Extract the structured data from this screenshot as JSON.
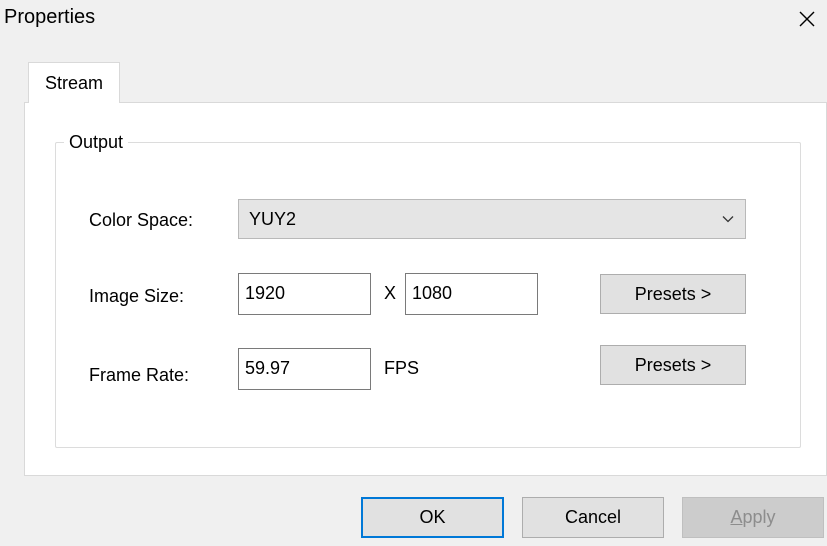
{
  "window": {
    "title": "Properties",
    "close_icon": "close-icon"
  },
  "tabs": [
    {
      "label": "Stream",
      "selected": true
    }
  ],
  "output_group": {
    "legend": "Output",
    "color_space": {
      "label": "Color Space:",
      "value": "YUY2",
      "arrow_icon": "chevron-down-icon"
    },
    "image_size": {
      "label": "Image Size:",
      "width": "1920",
      "separator": "X",
      "height": "1080",
      "presets_label": "Presets >"
    },
    "frame_rate": {
      "label": "Frame Rate:",
      "value": "59.97",
      "unit": "FPS",
      "presets_label": "Presets >"
    }
  },
  "footer": {
    "ok_label": "OK",
    "cancel_label": "Cancel",
    "apply_label_prefix": "A",
    "apply_label_rest": "pply",
    "apply_disabled": true
  },
  "colors": {
    "dialog_bg": "#f0f0f0",
    "panel_bg": "#ffffff",
    "default_button_border": "#0078d7",
    "disabled_text": "#8d8d8d"
  }
}
